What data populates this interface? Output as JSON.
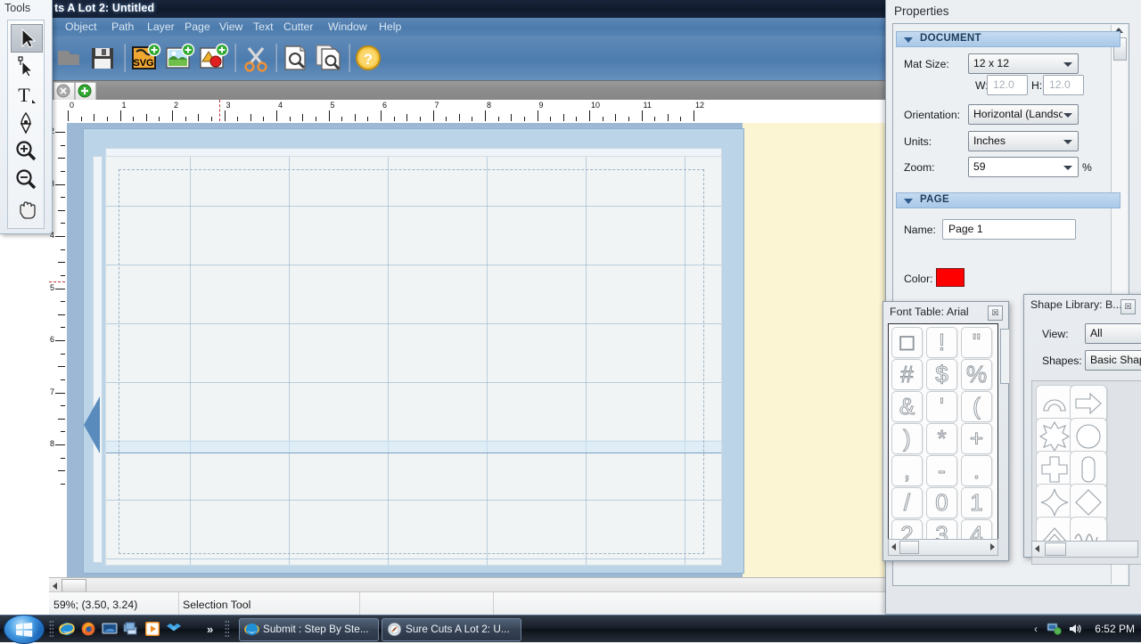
{
  "app": {
    "title": "ts A Lot 2: Untitled",
    "menu": [
      "Object",
      "Path",
      "Layer",
      "Page",
      "View",
      "Text",
      "Cutter",
      "Window",
      "Help"
    ],
    "toolbar_icons": [
      "open-icon",
      "save-icon",
      "import-svg-icon",
      "import-image-icon",
      "import-shape-icon",
      "cut-icon",
      "preview-icon",
      "print-preview-icon",
      "help-icon"
    ],
    "tabstrip": {
      "close_icon": "close-tab-icon",
      "add_icon": "add-tab-icon"
    }
  },
  "tools": {
    "title": "Tools",
    "items": [
      {
        "name": "selection-tool",
        "glyph": "arrow",
        "selected": true
      },
      {
        "name": "node-edit-tool",
        "glyph": "node",
        "selected": false
      },
      {
        "name": "text-tool",
        "glyph": "T",
        "selected": false
      },
      {
        "name": "pen-tool",
        "glyph": "pen",
        "selected": false
      },
      {
        "name": "zoom-in-tool",
        "glyph": "zoom-in",
        "selected": false
      },
      {
        "name": "zoom-out-tool",
        "glyph": "zoom-out",
        "selected": false
      },
      {
        "name": "pan-tool",
        "glyph": "hand",
        "selected": false
      }
    ]
  },
  "ruler": {
    "horizontal_labels": [
      "0",
      "1",
      "2",
      "3",
      "4",
      "5",
      "6",
      "7",
      "8",
      "9",
      "10",
      "11",
      "12"
    ],
    "vertical_labels": [
      "2",
      "3",
      "4",
      "5",
      "6",
      "7",
      "8"
    ],
    "units": "inches"
  },
  "properties": {
    "title": "Properties",
    "document": {
      "section_label": "DOCUMENT",
      "mat_size_label": "Mat Size:",
      "mat_size_value": "12 x 12",
      "w_label": "W:",
      "w_value": "12.0",
      "h_label": "H:",
      "h_value": "12.0",
      "orientation_label": "Orientation:",
      "orientation_value": "Horizontal (Landscap",
      "units_label": "Units:",
      "units_value": "Inches",
      "zoom_label": "Zoom:",
      "zoom_value": "59",
      "zoom_suffix": "%"
    },
    "page": {
      "section_label": "PAGE",
      "name_label": "Name:",
      "name_value": "Page 1",
      "color_label": "Color:",
      "color_value": "#ff0000"
    }
  },
  "font_table": {
    "title": "Font Table: Arial",
    "close_label": "☒",
    "glyphs": [
      "□",
      "!",
      "\"",
      "#",
      "$",
      "%",
      "&",
      "'",
      "(",
      ")",
      "*",
      "+",
      ",",
      "-",
      ".",
      "/",
      "0",
      "1",
      "2",
      "3",
      "4"
    ]
  },
  "shape_library": {
    "title": "Shape Library: B...",
    "close_label": "☒",
    "view_label": "View:",
    "view_value": "All",
    "shapes_label": "Shapes:",
    "shapes_value": "Basic Shap",
    "shape_names": [
      "arc-shape",
      "arrow-right-shape",
      "burst-shape",
      "circle-shape",
      "cross-shape",
      "rounded-rect-shape",
      "star4-shape",
      "diamond-shape",
      "chevron-shape",
      "wave-shape"
    ]
  },
  "statusbar": {
    "zoom_coords": "59%; (3.50, 3.24)",
    "tool": "Selection Tool"
  },
  "taskbar": {
    "start_name": "start-orb",
    "quick_launch": [
      "internet-explorer-icon",
      "firefox-icon",
      "show-desktop-icon",
      "switch-windows-icon",
      "media-player-icon",
      "dropbox-icon"
    ],
    "overflow_label": "»",
    "tasks": [
      {
        "label": "Submit : Step By Ste...",
        "icon": "internet-explorer-icon"
      },
      {
        "label": "Sure Cuts A Lot 2: U...",
        "icon": "scal-icon"
      }
    ],
    "tray_arrow": "‹",
    "tray_icons": [
      "network-icon",
      "volume-icon"
    ],
    "time": "6:52 PM"
  },
  "colors": {
    "titlebar": "#131d30",
    "menubar": "#4d7cae",
    "mat": "#bcd4e8",
    "paper": "#fcf5d4",
    "accent": "#a9c8e8"
  }
}
